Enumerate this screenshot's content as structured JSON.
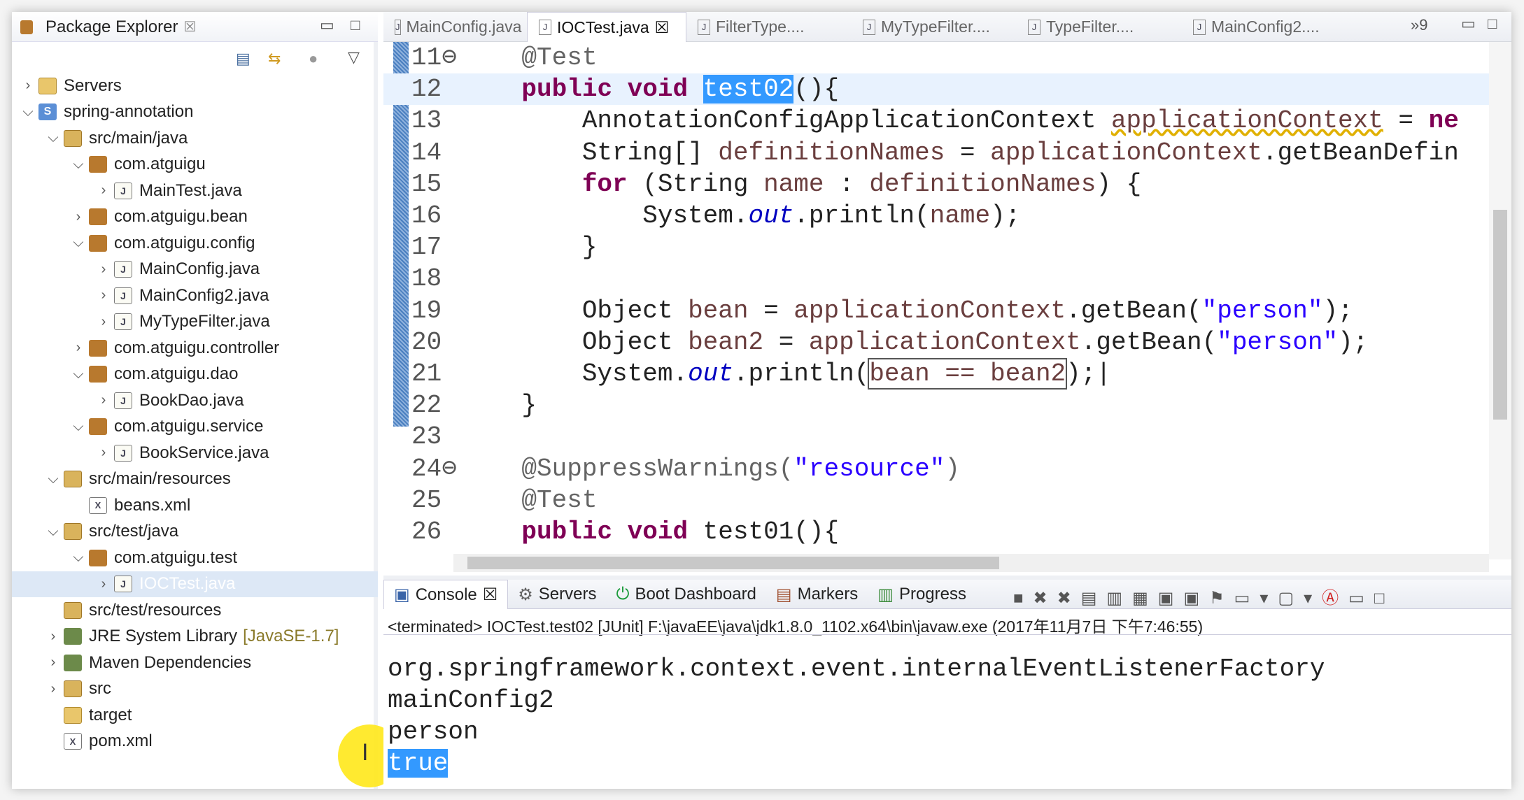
{
  "package_explorer": {
    "title": "Package Explorer",
    "close": "☒",
    "items": [
      {
        "label": "Servers",
        "level": 0,
        "arrow": "›",
        "icon": "folder"
      },
      {
        "label": "spring-annotation",
        "level": 0,
        "arrow": "⌄",
        "icon": "project"
      },
      {
        "label": "src/main/java",
        "level": 1,
        "arrow": "⌄",
        "icon": "srcfolder"
      },
      {
        "label": "com.atguigu",
        "level": 2,
        "arrow": "⌄",
        "icon": "package"
      },
      {
        "label": "MainTest.java",
        "level": 3,
        "arrow": "›",
        "icon": "java"
      },
      {
        "label": "com.atguigu.bean",
        "level": 2,
        "arrow": "›",
        "icon": "package"
      },
      {
        "label": "com.atguigu.config",
        "level": 2,
        "arrow": "⌄",
        "icon": "package"
      },
      {
        "label": "MainConfig.java",
        "level": 3,
        "arrow": "›",
        "icon": "java"
      },
      {
        "label": "MainConfig2.java",
        "level": 3,
        "arrow": "›",
        "icon": "java"
      },
      {
        "label": "MyTypeFilter.java",
        "level": 3,
        "arrow": "›",
        "icon": "java"
      },
      {
        "label": "com.atguigu.controller",
        "level": 2,
        "arrow": "›",
        "icon": "package"
      },
      {
        "label": "com.atguigu.dao",
        "level": 2,
        "arrow": "⌄",
        "icon": "package"
      },
      {
        "label": "BookDao.java",
        "level": 3,
        "arrow": "›",
        "icon": "java"
      },
      {
        "label": "com.atguigu.service",
        "level": 2,
        "arrow": "⌄",
        "icon": "package"
      },
      {
        "label": "BookService.java",
        "level": 3,
        "arrow": "›",
        "icon": "java"
      },
      {
        "label": "src/main/resources",
        "level": 1,
        "arrow": "⌄",
        "icon": "srcfolder"
      },
      {
        "label": "beans.xml",
        "level": 2,
        "arrow": "",
        "icon": "xml"
      },
      {
        "label": "src/test/java",
        "level": 1,
        "arrow": "⌄",
        "icon": "srcfolder"
      },
      {
        "label": "com.atguigu.test",
        "level": 2,
        "arrow": "⌄",
        "icon": "package"
      },
      {
        "label": "IOCTest.java",
        "level": 3,
        "arrow": "›",
        "icon": "java",
        "selected": true
      },
      {
        "label": "src/test/resources",
        "level": 1,
        "arrow": "",
        "icon": "srcfolder"
      },
      {
        "label": "JRE System Library",
        "deco": "[JavaSE-1.7]",
        "level": 1,
        "arrow": "›",
        "icon": "lib"
      },
      {
        "label": "Maven Dependencies",
        "level": 1,
        "arrow": "›",
        "icon": "lib"
      },
      {
        "label": "src",
        "level": 1,
        "arrow": "›",
        "icon": "srcfolder"
      },
      {
        "label": "target",
        "level": 1,
        "arrow": "",
        "icon": "folder"
      },
      {
        "label": "pom.xml",
        "level": 1,
        "arrow": "",
        "icon": "xml"
      }
    ]
  },
  "editor": {
    "tabs": [
      {
        "label": "MainConfig.java"
      },
      {
        "label": "IOCTest.java",
        "active": true,
        "close": "☒"
      },
      {
        "label": "FilterType...."
      },
      {
        "label": "MyTypeFilter...."
      },
      {
        "label": "TypeFilter...."
      },
      {
        "label": "MainConfig2...."
      }
    ],
    "overflow": "»9",
    "lines": [
      {
        "n": "11⊖",
        "tokens": [
          {
            "t": "    "
          },
          {
            "t": "@Test",
            "c": "ann"
          }
        ]
      },
      {
        "n": "12",
        "current": true,
        "tokens": [
          {
            "t": "    "
          },
          {
            "t": "public void ",
            "c": "kw"
          },
          {
            "t": "test02",
            "c": "sel"
          },
          {
            "t": "(){"
          }
        ]
      },
      {
        "n": "13",
        "tokens": [
          {
            "t": "        AnnotationConfigApplicationContext "
          },
          {
            "t": "applicationContext",
            "c": "var warn"
          },
          {
            "t": " = "
          },
          {
            "t": "ne",
            "c": "kw"
          }
        ]
      },
      {
        "n": "14",
        "tokens": [
          {
            "t": "        String[] "
          },
          {
            "t": "definitionNames",
            "c": "var"
          },
          {
            "t": " = "
          },
          {
            "t": "applicationContext",
            "c": "var"
          },
          {
            "t": ".getBeanDefin"
          }
        ]
      },
      {
        "n": "15",
        "tokens": [
          {
            "t": "        "
          },
          {
            "t": "for",
            "c": "kw"
          },
          {
            "t": " (String "
          },
          {
            "t": "name",
            "c": "var"
          },
          {
            "t": " : "
          },
          {
            "t": "definitionNames",
            "c": "var"
          },
          {
            "t": ") {"
          }
        ]
      },
      {
        "n": "16",
        "tokens": [
          {
            "t": "            System."
          },
          {
            "t": "out",
            "c": "field"
          },
          {
            "t": ".println("
          },
          {
            "t": "name",
            "c": "var"
          },
          {
            "t": ");"
          }
        ]
      },
      {
        "n": "17",
        "tokens": [
          {
            "t": "        }"
          }
        ]
      },
      {
        "n": "18",
        "tokens": [
          {
            "t": ""
          }
        ]
      },
      {
        "n": "19",
        "tokens": [
          {
            "t": "        Object "
          },
          {
            "t": "bean",
            "c": "var"
          },
          {
            "t": " = "
          },
          {
            "t": "applicationContext",
            "c": "var"
          },
          {
            "t": ".getBean("
          },
          {
            "t": "\"person\"",
            "c": "str"
          },
          {
            "t": ");"
          }
        ]
      },
      {
        "n": "20",
        "tokens": [
          {
            "t": "        Object "
          },
          {
            "t": "bean2",
            "c": "var"
          },
          {
            "t": " = "
          },
          {
            "t": "applicationContext",
            "c": "var"
          },
          {
            "t": ".getBean("
          },
          {
            "t": "\"person\"",
            "c": "str"
          },
          {
            "t": ");"
          }
        ]
      },
      {
        "n": "21",
        "tokens": [
          {
            "t": "        System."
          },
          {
            "t": "out",
            "c": "field"
          },
          {
            "t": ".println("
          },
          {
            "t": "bean == bean2",
            "c": "var box"
          },
          {
            "t": ");|"
          }
        ]
      },
      {
        "n": "22",
        "tokens": [
          {
            "t": "    }"
          }
        ]
      },
      {
        "n": "23",
        "tokens": [
          {
            "t": ""
          }
        ]
      },
      {
        "n": "24⊖",
        "tokens": [
          {
            "t": "    "
          },
          {
            "t": "@SuppressWarnings(",
            "c": "ann"
          },
          {
            "t": "\"resource\"",
            "c": "str"
          },
          {
            "t": ")",
            "c": "ann"
          }
        ]
      },
      {
        "n": "25",
        "tokens": [
          {
            "t": "    "
          },
          {
            "t": "@Test",
            "c": "ann"
          }
        ]
      },
      {
        "n": "26",
        "tokens": [
          {
            "t": "    "
          },
          {
            "t": "public void ",
            "c": "kw"
          },
          {
            "t": "test01(){"
          }
        ]
      }
    ]
  },
  "console": {
    "tabs": [
      {
        "label": "Console",
        "active": true,
        "close": "☒"
      },
      {
        "label": "Servers"
      },
      {
        "label": "Boot Dashboard"
      },
      {
        "label": "Markers"
      },
      {
        "label": "Progress"
      }
    ],
    "status": "<terminated> IOCTest.test02 [JUnit] F:\\javaEE\\java\\jdk1.8.0_1102.x64\\bin\\javaw.exe (2017年11月7日 下午7:46:55)",
    "output": [
      "org.springframework.context.event.internalEventListenerFactory",
      "mainConfig2",
      "person",
      "true"
    ]
  }
}
